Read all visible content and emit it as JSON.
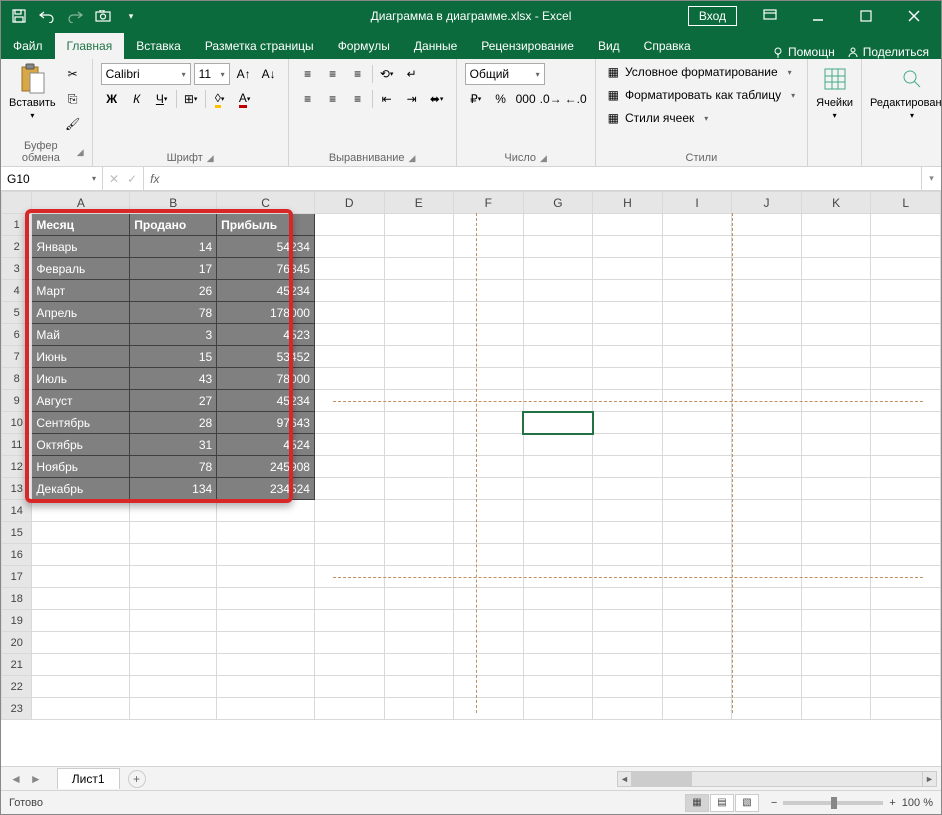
{
  "titlebar": {
    "title": "Диаграмма в диаграмме.xlsx - Excel",
    "login": "Вход"
  },
  "tabs": {
    "file": "Файл",
    "home": "Главная",
    "insert": "Вставка",
    "layout": "Разметка страницы",
    "formulas": "Формулы",
    "data": "Данные",
    "review": "Рецензирование",
    "view": "Вид",
    "help": "Справка",
    "tell": "Помощн",
    "share": "Поделиться"
  },
  "ribbon": {
    "paste": "Вставить",
    "clipboard": "Буфер обмена",
    "font_name": "Calibri",
    "font_size": "11",
    "font": "Шрифт",
    "alignment": "Выравнивание",
    "number_format": "Общий",
    "number": "Число",
    "cond": "Условное форматирование",
    "table": "Форматировать как таблицу",
    "cellstyles": "Стили ячеек",
    "styles": "Стили",
    "cells": "Ячейки",
    "editing": "Редактирование"
  },
  "formula_bar": {
    "cell_ref": "G10",
    "formula": ""
  },
  "columns": [
    "A",
    "B",
    "C",
    "D",
    "E",
    "F",
    "G",
    "H",
    "I",
    "J",
    "K",
    "L"
  ],
  "table": {
    "headers": {
      "month": "Месяц",
      "sold": "Продано",
      "profit": "Прибыль"
    },
    "rows": [
      {
        "month": "Январь",
        "sold": "14",
        "profit": "54234"
      },
      {
        "month": "Февраль",
        "sold": "17",
        "profit": "76345"
      },
      {
        "month": "Март",
        "sold": "26",
        "profit": "45234"
      },
      {
        "month": "Апрель",
        "sold": "78",
        "profit": "178000"
      },
      {
        "month": "Май",
        "sold": "3",
        "profit": "4523"
      },
      {
        "month": "Июнь",
        "sold": "15",
        "profit": "53452"
      },
      {
        "month": "Июль",
        "sold": "43",
        "profit": "78000"
      },
      {
        "month": "Август",
        "sold": "27",
        "profit": "45234"
      },
      {
        "month": "Сентябрь",
        "sold": "28",
        "profit": "97643"
      },
      {
        "month": "Октябрь",
        "sold": "31",
        "profit": "4524"
      },
      {
        "month": "Ноябрь",
        "sold": "78",
        "profit": "245908"
      },
      {
        "month": "Декабрь",
        "sold": "134",
        "profit": "234524"
      }
    ]
  },
  "sheet": {
    "name": "Лист1"
  },
  "status": {
    "ready": "Готово",
    "zoom": "100 %"
  }
}
